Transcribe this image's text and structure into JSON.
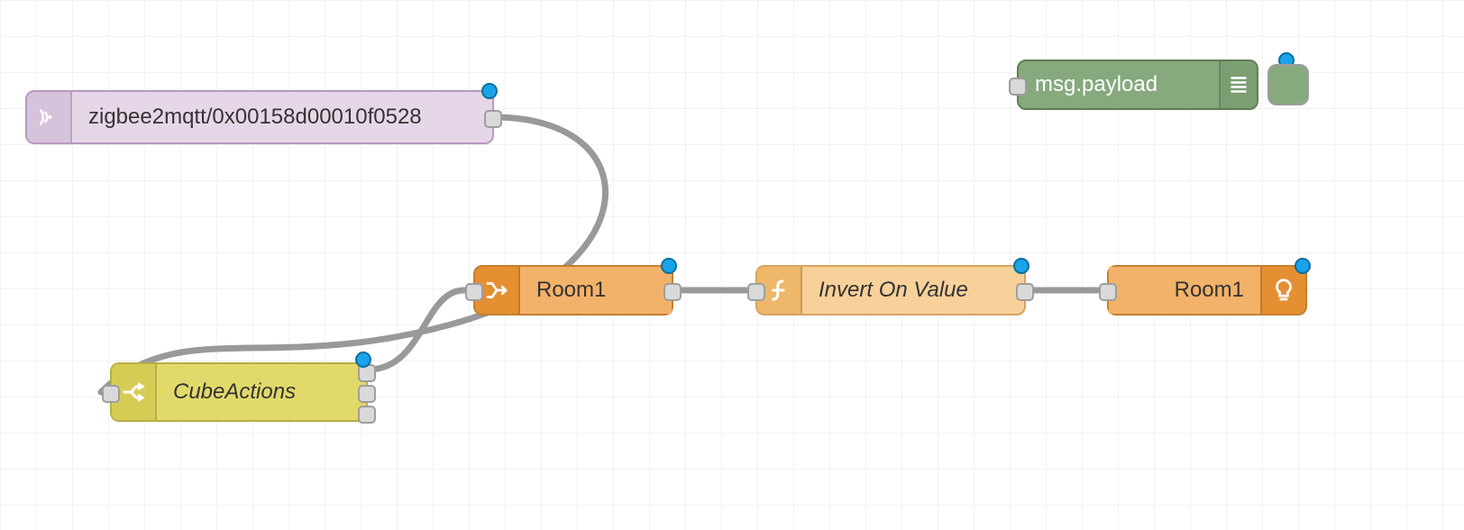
{
  "nodes": {
    "mqtt_in": {
      "label": "zigbee2mqtt/0x00158d00010f0528"
    },
    "switch": {
      "label": "CubeActions"
    },
    "ha_in": {
      "label": "Room1"
    },
    "func": {
      "label": "Invert On Value"
    },
    "ha_out": {
      "label": "Room1"
    },
    "debug": {
      "label": "msg.payload"
    }
  }
}
